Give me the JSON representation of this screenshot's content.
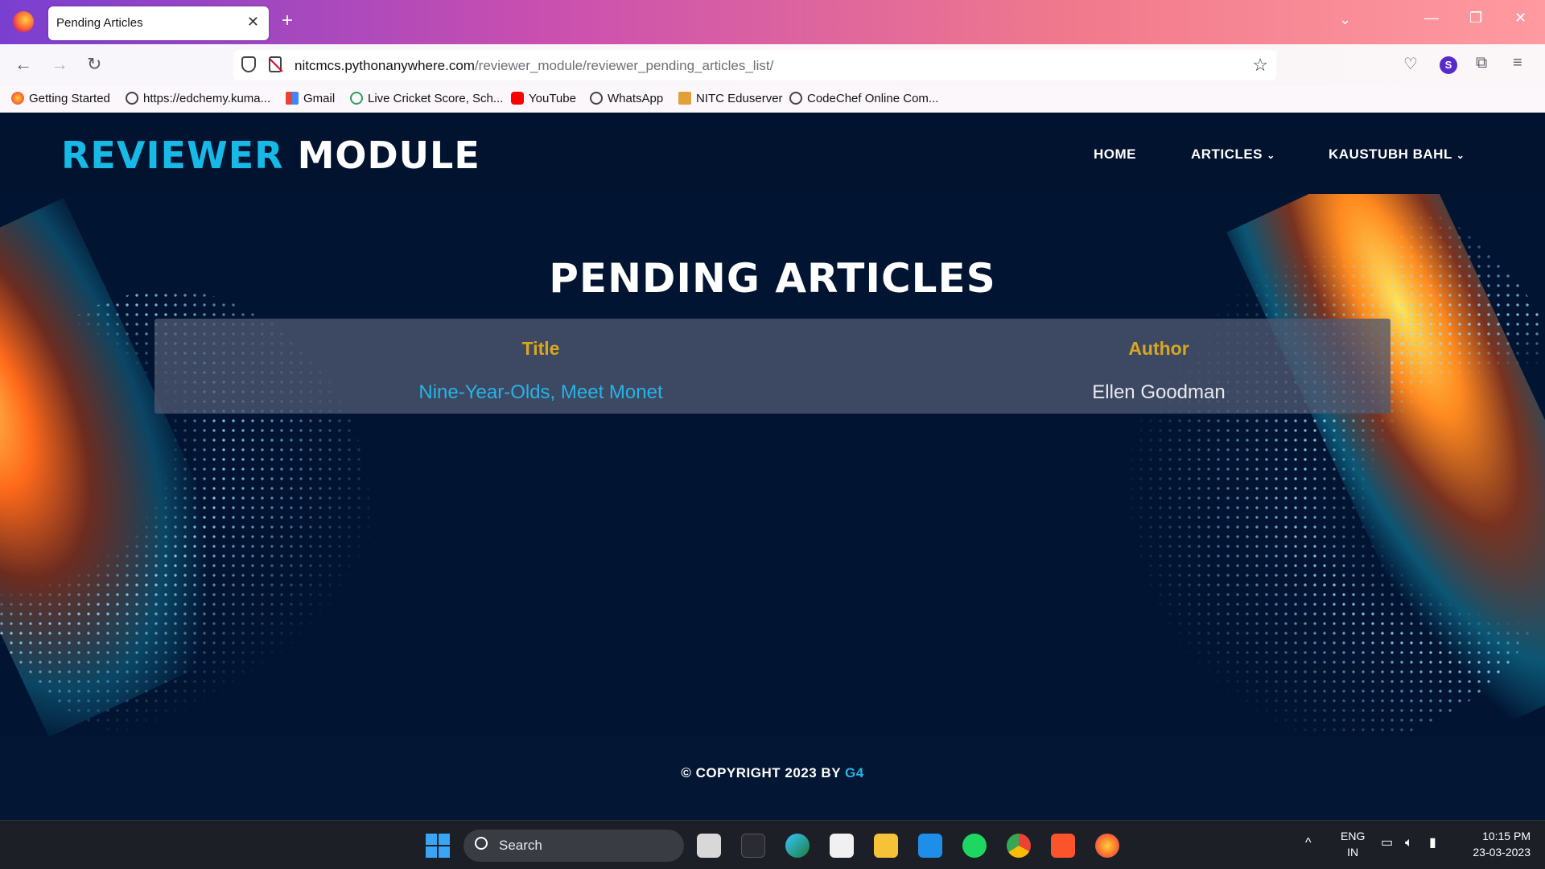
{
  "browser": {
    "tab_title": "Pending Articles",
    "url_host": "nitcmcs.pythonanywhere.com",
    "url_path": "/reviewer_module/reviewer_pending_articles_list/",
    "profile_initial": "S",
    "bookmarks": [
      {
        "label": "Getting Started",
        "icon": "firefox-icon"
      },
      {
        "label": "https://edchemy.kuma...",
        "icon": "globe-icon"
      },
      {
        "label": "Gmail",
        "icon": "gmail-icon"
      },
      {
        "label": "Live Cricket Score, Sch...",
        "icon": "cricbuzz-icon"
      },
      {
        "label": "YouTube",
        "icon": "youtube-icon"
      },
      {
        "label": "WhatsApp",
        "icon": "globe-icon"
      },
      {
        "label": "NITC Eduserver",
        "icon": "nitc-icon"
      },
      {
        "label": "CodeChef Online Com...",
        "icon": "globe-icon"
      }
    ]
  },
  "site": {
    "brand_accent": "REVIEWER",
    "brand_rest": "MODULE",
    "nav": {
      "home": "HOME",
      "articles": "ARTICLES",
      "user": "KAUSTUBH BAHL"
    },
    "page_title": "PENDING ARTICLES",
    "table": {
      "headers": {
        "title": "Title",
        "author": "Author"
      },
      "rows": [
        {
          "title": "Nine-Year-Olds, Meet Monet",
          "author": "Ellen Goodman"
        }
      ]
    },
    "footer": {
      "text": "© COPYRIGHT 2023 BY",
      "link": "G4"
    },
    "colors": {
      "accent": "#17b9e6",
      "header_gold": "#d7a722",
      "background": "#011432"
    }
  },
  "taskbar": {
    "search_label": "Search",
    "lang": "ENG",
    "region": "IN",
    "time": "10:15 PM",
    "date": "23-03-2023"
  }
}
